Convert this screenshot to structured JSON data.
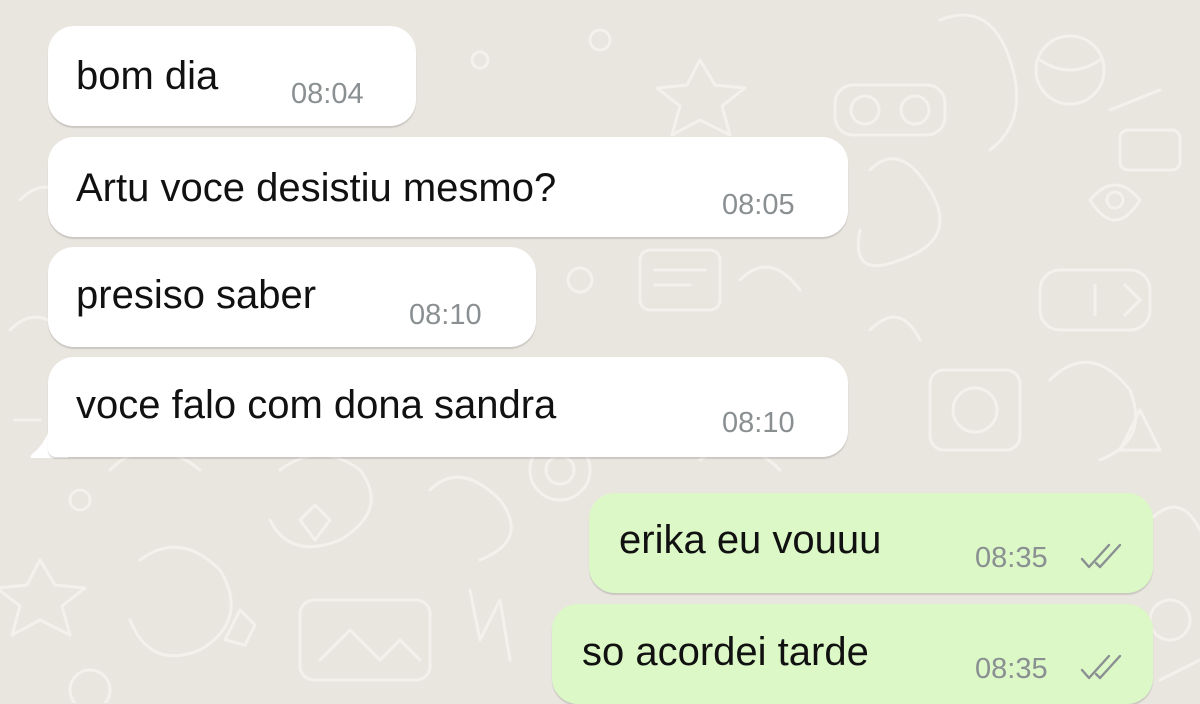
{
  "chat": {
    "messages": [
      {
        "direction": "incoming",
        "text": "bom dia",
        "time": "08:04"
      },
      {
        "direction": "incoming",
        "text": "Artu voce desistiu mesmo?",
        "time": "08:05"
      },
      {
        "direction": "incoming",
        "text": "presiso saber",
        "time": "08:10"
      },
      {
        "direction": "incoming",
        "text": "voce falo com dona sandra",
        "time": "08:10"
      },
      {
        "direction": "outgoing",
        "text": "erika eu vouuu",
        "time": "08:35",
        "status_icon": "double-check-icon"
      },
      {
        "direction": "outgoing",
        "text": "so acordei tarde",
        "time": "08:35",
        "status_icon": "double-check-icon"
      }
    ]
  },
  "colors": {
    "chat_background": "#e9e5df",
    "incoming_bubble": "#ffffff",
    "outgoing_bubble": "#dcf8c6",
    "timestamp": "#8a8f92"
  }
}
